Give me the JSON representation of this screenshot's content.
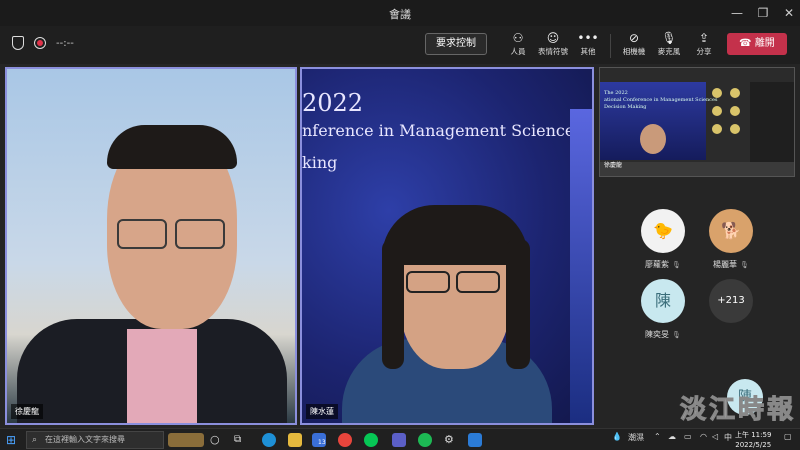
{
  "window": {
    "title": "會議"
  },
  "toolbar": {
    "timer": "--:--",
    "control_label": "要求控制",
    "people_label": "人員",
    "reactions_label": "表情符號",
    "more_label": "其他",
    "camera_label": "相機機",
    "mic_label": "麥克風",
    "share_label": "分享",
    "leave_label": "離開"
  },
  "participants": {
    "main1_name": "徐慶龍",
    "main2_name": "陳水蓮",
    "gallery": [
      {
        "name": "廖蘿紫",
        "initial": ""
      },
      {
        "name": "楊麗華",
        "initial": ""
      },
      {
        "name": "陳奕旻",
        "initial": "陳"
      },
      {
        "name": "",
        "initial": "+213"
      }
    ],
    "mini_name": "徐慶龍",
    "corner_initial": "陳"
  },
  "slide": {
    "year": "2022",
    "line1": "nference in Management Sciences",
    "line2": "king",
    "mini_line1": "The 2022",
    "mini_line2": "ational Conference in Management Sciences",
    "mini_line3": "Decision Making"
  },
  "watermark": "淡江時報",
  "taskbar": {
    "search_placeholder": "在這裡輸入文字來搜尋",
    "badge_count": "13",
    "weather": "潮濕",
    "lang": "中",
    "time": "上午 11:59",
    "date": "2022/5/25"
  },
  "colors": {
    "accent": "#8b8fdd",
    "leave": "#c4314b",
    "avatar_blue": "#c8e8ef"
  }
}
